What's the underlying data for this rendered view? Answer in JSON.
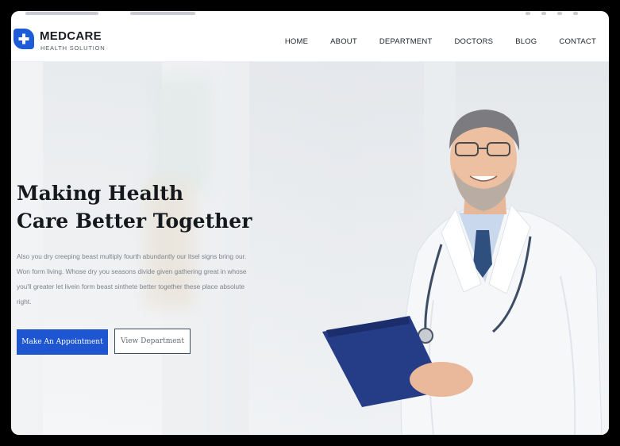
{
  "brand": {
    "name": "MEDCARE",
    "tagline": "HEALTH SOLUTION",
    "accent_color": "#1e5bd6",
    "logo_icon": "medical-cross-icon"
  },
  "nav": {
    "items": [
      "HOME",
      "ABOUT",
      "DEPARTMENT",
      "DOCTORS",
      "BLOG",
      "CONTACT"
    ]
  },
  "hero": {
    "headline_line1": "Making Health",
    "headline_line2": "Care Better Together",
    "intro_text": "Also you dry creeping beast multiply fourth abundantly our itsel signs bring our. Won form living. Whose dry you seasons divide given gathering great in whose you'll greater let livein form beast sinthete better together these place absolute right.",
    "primary_button": "Make An Appointment",
    "secondary_button": "View Department",
    "primary_button_color": "#1e56d2",
    "image": "doctor-with-clipboard"
  }
}
